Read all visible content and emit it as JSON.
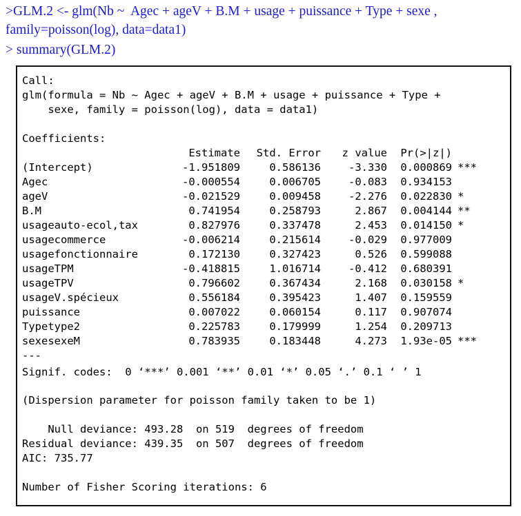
{
  "console": {
    "command_line1": ">GLM.2 <- glm(Nb ~  Agec + ageV + B.M + usage + puissance + Type + sexe ,",
    "command_line2": "family=poisson(log), data=data1)",
    "command_line3": "> summary(GLM.2)"
  },
  "output": {
    "call_label": "Call:",
    "call_line1": "glm(formula = Nb ~ Agec + ageV + B.M + usage + puissance + Type +",
    "call_line2": "    sexe, family = poisson(log), data = data1)",
    "coefficients_label": "Coefficients:",
    "table": {
      "headers": [
        "",
        "Estimate",
        "Std. Error",
        "z value",
        "Pr(>|z|)",
        ""
      ],
      "rows": [
        [
          "(Intercept)",
          "-1.951809",
          "0.586136",
          "-3.330",
          "0.000869",
          "***"
        ],
        [
          "Agec",
          "-0.000554",
          "0.006705",
          "-0.083",
          "0.934153",
          ""
        ],
        [
          "ageV",
          "-0.021529",
          "0.009458",
          "-2.276",
          "0.022830",
          "*"
        ],
        [
          "B.M",
          "0.741954",
          "0.258793",
          "2.867",
          "0.004144",
          "**"
        ],
        [
          "usageauto-ecol,tax",
          "0.827976",
          "0.337478",
          "2.453",
          "0.014150",
          "*"
        ],
        [
          "usagecommerce",
          "-0.006214",
          "0.215614",
          "-0.029",
          "0.977009",
          ""
        ],
        [
          "usagefonctionnaire",
          "0.172130",
          "0.327423",
          "0.526",
          "0.599088",
          ""
        ],
        [
          "usageTPM",
          "-0.418815",
          "1.016714",
          "-0.412",
          "0.680391",
          ""
        ],
        [
          "usageTPV",
          "0.796602",
          "0.367434",
          "2.168",
          "0.030158",
          "*"
        ],
        [
          "usageV.spécieux",
          "0.556184",
          "0.395423",
          "1.407",
          "0.159559",
          ""
        ],
        [
          "puissance",
          "0.007022",
          "0.060154",
          "0.117",
          "0.907074",
          ""
        ],
        [
          "Typetype2",
          "0.225783",
          "0.179999",
          "1.254",
          "0.209713",
          ""
        ],
        [
          "sexesexeM",
          "0.783935",
          "0.183448",
          "4.273",
          "1.93e-05",
          "***"
        ]
      ]
    },
    "separator": "---",
    "signif_codes": "Signif. codes:  0 ‘***’ 0.001 ‘**’ 0.01 ‘*’ 0.05 ‘.’ 0.1 ‘ ’ 1",
    "dispersion": "(Dispersion parameter for poisson family taken to be 1)",
    "null_deviance": "    Null deviance: 493.28  on 519  degrees of freedom",
    "residual_deviance": "Residual deviance: 439.35  on 507  degrees of freedom",
    "aic": "AIC: 735.77",
    "fisher_iterations": "Number of Fisher Scoring iterations: 6"
  }
}
